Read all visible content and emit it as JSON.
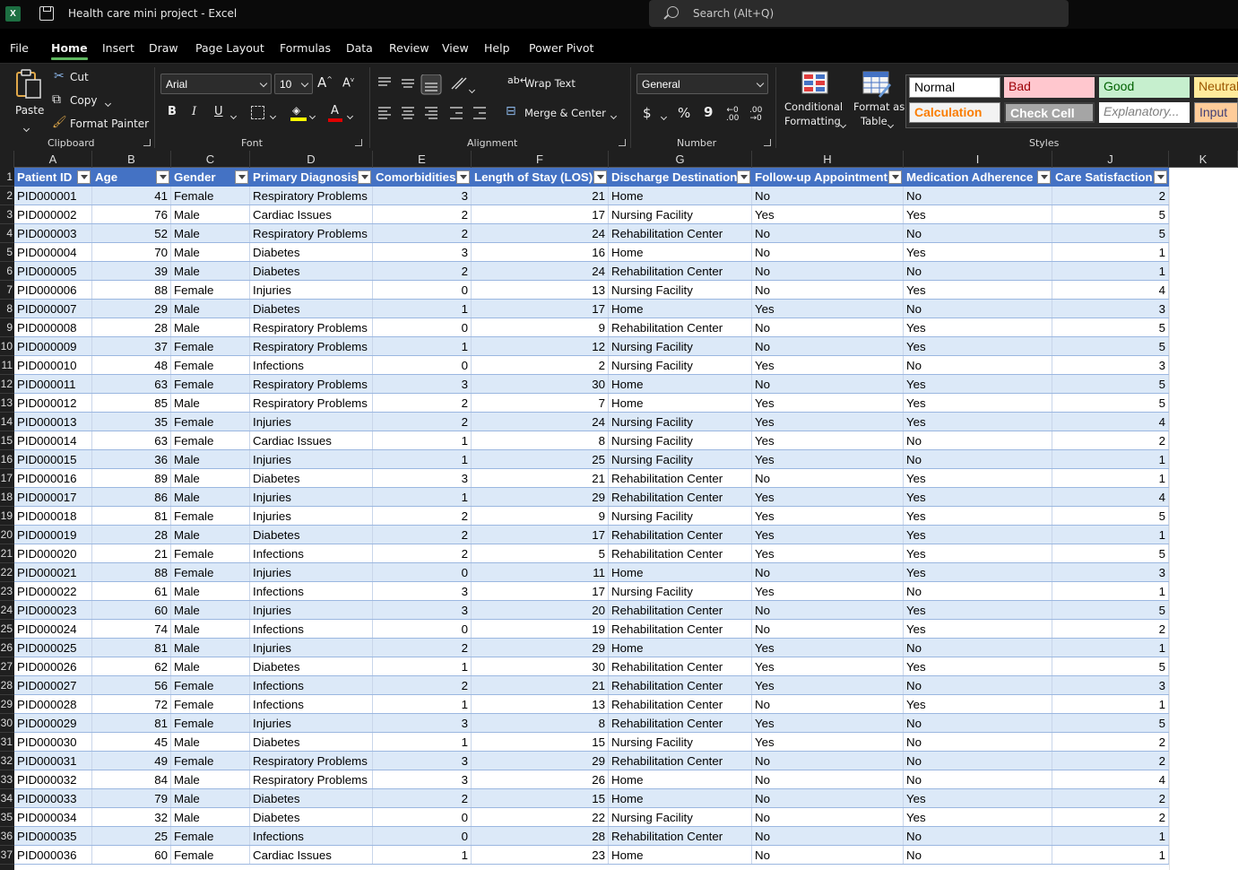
{
  "titlebar": {
    "app_icon_letter": "X",
    "title": "Health care mini project  -  Excel",
    "search_placeholder": "Search (Alt+Q)"
  },
  "menu": {
    "tabs": [
      {
        "label": "File"
      },
      {
        "label": "Home",
        "active": true
      },
      {
        "label": "Insert"
      },
      {
        "label": "Draw"
      },
      {
        "label": "Page Layout"
      },
      {
        "label": "Formulas"
      },
      {
        "label": "Data"
      },
      {
        "label": "Review"
      },
      {
        "label": "View"
      },
      {
        "label": "Help"
      },
      {
        "label": "Power Pivot"
      }
    ]
  },
  "ribbon": {
    "clipboard": {
      "label": "Clipboard",
      "paste": "Paste",
      "cut": "Cut",
      "copy": "Copy",
      "format_painter": "Format Painter"
    },
    "font": {
      "label": "Font",
      "font_name": "Arial",
      "font_size": "10",
      "bold": "B",
      "italic": "I",
      "underline": "U",
      "grow": "A",
      "shrink": "A"
    },
    "alignment": {
      "label": "Alignment",
      "wrap_text": "Wrap Text",
      "merge_center": "Merge & Center"
    },
    "number": {
      "label": "Number",
      "format": "General",
      "currency": "$",
      "percent": "%",
      "comma": "9"
    },
    "styles": {
      "label": "Styles",
      "conditional_formatting_line1": "Conditional",
      "conditional_formatting_line2": "Formatting",
      "format_as_table_line1": "Format as",
      "format_as_table_line2": "Table",
      "cells": [
        {
          "label": "Normal",
          "bg": "#ffffff",
          "color": "#000000"
        },
        {
          "label": "Bad",
          "bg": "#ffc7ce",
          "color": "#9c0006"
        },
        {
          "label": "Good",
          "bg": "#c6efce",
          "color": "#006100"
        },
        {
          "label": "Neutral",
          "bg": "#ffeb9c",
          "color": "#9c5700"
        },
        {
          "label": "Calculation",
          "bg": "#f2f2f2",
          "color": "#fa7d00"
        },
        {
          "label": "Check Cell",
          "bg": "#a5a5a5",
          "color": "#ffffff"
        },
        {
          "label": "Explanatory...",
          "bg": "#ffffff",
          "color": "#7f7f7f"
        },
        {
          "label": "Input",
          "bg": "#ffcc99",
          "color": "#3f3f76"
        }
      ]
    }
  },
  "sheet": {
    "column_letters": [
      "A",
      "B",
      "C",
      "D",
      "E",
      "F",
      "G",
      "H",
      "I",
      "J",
      "K"
    ],
    "headers": [
      "Patient ID",
      "Age",
      "Gender",
      "Primary Diagnosis",
      "Comorbidities",
      "Length of Stay (LOS)",
      "Discharge Destination",
      "Follow-up Appointment",
      "Medication Adherence",
      "Care Satisfaction"
    ],
    "rows": [
      [
        "PID000001",
        "41",
        "Female",
        "Respiratory Problems",
        "3",
        "21",
        "Home",
        "No",
        "No",
        "2"
      ],
      [
        "PID000002",
        "76",
        "Male",
        "Cardiac Issues",
        "2",
        "17",
        "Nursing Facility",
        "Yes",
        "Yes",
        "5"
      ],
      [
        "PID000003",
        "52",
        "Male",
        "Respiratory Problems",
        "2",
        "24",
        "Rehabilitation Center",
        "No",
        "No",
        "5"
      ],
      [
        "PID000004",
        "70",
        "Male",
        "Diabetes",
        "3",
        "16",
        "Home",
        "No",
        "Yes",
        "1"
      ],
      [
        "PID000005",
        "39",
        "Male",
        "Diabetes",
        "2",
        "24",
        "Rehabilitation Center",
        "No",
        "No",
        "1"
      ],
      [
        "PID000006",
        "88",
        "Female",
        "Injuries",
        "0",
        "13",
        "Nursing Facility",
        "No",
        "Yes",
        "4"
      ],
      [
        "PID000007",
        "29",
        "Male",
        "Diabetes",
        "1",
        "17",
        "Home",
        "Yes",
        "No",
        "3"
      ],
      [
        "PID000008",
        "28",
        "Male",
        "Respiratory Problems",
        "0",
        "9",
        "Rehabilitation Center",
        "No",
        "Yes",
        "5"
      ],
      [
        "PID000009",
        "37",
        "Female",
        "Respiratory Problems",
        "1",
        "12",
        "Nursing Facility",
        "No",
        "Yes",
        "5"
      ],
      [
        "PID000010",
        "48",
        "Female",
        "Infections",
        "0",
        "2",
        "Nursing Facility",
        "Yes",
        "No",
        "3"
      ],
      [
        "PID000011",
        "63",
        "Female",
        "Respiratory Problems",
        "3",
        "30",
        "Home",
        "No",
        "Yes",
        "5"
      ],
      [
        "PID000012",
        "85",
        "Male",
        "Respiratory Problems",
        "2",
        "7",
        "Home",
        "Yes",
        "Yes",
        "5"
      ],
      [
        "PID000013",
        "35",
        "Female",
        "Injuries",
        "2",
        "24",
        "Nursing Facility",
        "Yes",
        "Yes",
        "4"
      ],
      [
        "PID000014",
        "63",
        "Female",
        "Cardiac Issues",
        "1",
        "8",
        "Nursing Facility",
        "Yes",
        "No",
        "2"
      ],
      [
        "PID000015",
        "36",
        "Male",
        "Injuries",
        "1",
        "25",
        "Nursing Facility",
        "Yes",
        "No",
        "1"
      ],
      [
        "PID000016",
        "89",
        "Male",
        "Diabetes",
        "3",
        "21",
        "Rehabilitation Center",
        "No",
        "Yes",
        "1"
      ],
      [
        "PID000017",
        "86",
        "Male",
        "Injuries",
        "1",
        "29",
        "Rehabilitation Center",
        "Yes",
        "Yes",
        "4"
      ],
      [
        "PID000018",
        "81",
        "Female",
        "Injuries",
        "2",
        "9",
        "Nursing Facility",
        "Yes",
        "Yes",
        "5"
      ],
      [
        "PID000019",
        "28",
        "Male",
        "Diabetes",
        "2",
        "17",
        "Rehabilitation Center",
        "Yes",
        "Yes",
        "1"
      ],
      [
        "PID000020",
        "21",
        "Female",
        "Infections",
        "2",
        "5",
        "Rehabilitation Center",
        "Yes",
        "Yes",
        "5"
      ],
      [
        "PID000021",
        "88",
        "Female",
        "Injuries",
        "0",
        "11",
        "Home",
        "No",
        "Yes",
        "3"
      ],
      [
        "PID000022",
        "61",
        "Male",
        "Infections",
        "3",
        "17",
        "Nursing Facility",
        "Yes",
        "No",
        "1"
      ],
      [
        "PID000023",
        "60",
        "Male",
        "Injuries",
        "3",
        "20",
        "Rehabilitation Center",
        "No",
        "Yes",
        "5"
      ],
      [
        "PID000024",
        "74",
        "Male",
        "Infections",
        "0",
        "19",
        "Rehabilitation Center",
        "No",
        "Yes",
        "2"
      ],
      [
        "PID000025",
        "81",
        "Male",
        "Injuries",
        "2",
        "29",
        "Home",
        "Yes",
        "No",
        "1"
      ],
      [
        "PID000026",
        "62",
        "Male",
        "Diabetes",
        "1",
        "30",
        "Rehabilitation Center",
        "Yes",
        "Yes",
        "5"
      ],
      [
        "PID000027",
        "56",
        "Female",
        "Infections",
        "2",
        "21",
        "Rehabilitation Center",
        "Yes",
        "No",
        "3"
      ],
      [
        "PID000028",
        "72",
        "Female",
        "Infections",
        "1",
        "13",
        "Rehabilitation Center",
        "No",
        "Yes",
        "1"
      ],
      [
        "PID000029",
        "81",
        "Female",
        "Injuries",
        "3",
        "8",
        "Rehabilitation Center",
        "Yes",
        "No",
        "5"
      ],
      [
        "PID000030",
        "45",
        "Male",
        "Diabetes",
        "1",
        "15",
        "Nursing Facility",
        "Yes",
        "No",
        "2"
      ],
      [
        "PID000031",
        "49",
        "Female",
        "Respiratory Problems",
        "3",
        "29",
        "Rehabilitation Center",
        "No",
        "No",
        "2"
      ],
      [
        "PID000032",
        "84",
        "Male",
        "Respiratory Problems",
        "3",
        "26",
        "Home",
        "No",
        "No",
        "4"
      ],
      [
        "PID000033",
        "79",
        "Male",
        "Diabetes",
        "2",
        "15",
        "Home",
        "No",
        "Yes",
        "2"
      ],
      [
        "PID000034",
        "32",
        "Male",
        "Diabetes",
        "0",
        "22",
        "Nursing Facility",
        "No",
        "Yes",
        "2"
      ],
      [
        "PID000035",
        "25",
        "Female",
        "Infections",
        "0",
        "28",
        "Rehabilitation Center",
        "No",
        "No",
        "1"
      ],
      [
        "PID000036",
        "60",
        "Female",
        "Cardiac Issues",
        "1",
        "23",
        "Home",
        "No",
        "No",
        "1"
      ]
    ]
  }
}
